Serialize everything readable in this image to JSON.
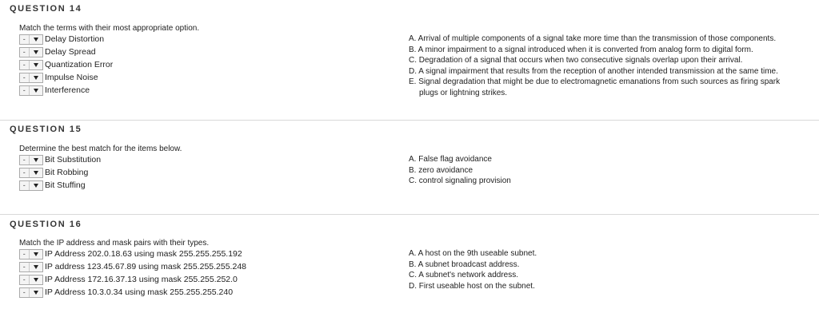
{
  "questions": [
    {
      "title": "QUESTION 14",
      "prompt": "Match the terms with their most appropriate option.",
      "terms": [
        "Delay Distortion",
        "Delay Spread",
        "Quantization Error",
        "Impulse Noise",
        "Interference"
      ],
      "dropdown_value": "-",
      "options": [
        "A. Arrival of multiple components of a signal take more time than the transmission of those components.",
        "B. A minor impairment to a signal introduced when it is converted from analog form to digital form.",
        "C. Degradation of a signal that occurs when two consecutive signals overlap upon their arrival.",
        "D. A signal impairment that results from the reception of another intended transmission at the same time.",
        "E. Signal degradation that might be due to electromagnetic emanations from such sources as firing spark"
      ],
      "option_continuation": "plugs or lightning strikes."
    },
    {
      "title": "QUESTION 15",
      "prompt": "Determine the best match for the items below.",
      "terms": [
        "Bit Substitution",
        "Bit Robbing",
        "Bit Stuffing"
      ],
      "dropdown_value": "-",
      "options": [
        "A. False flag avoidance",
        "B. zero avoidance",
        "C. control signaling provision"
      ]
    },
    {
      "title": "QUESTION 16",
      "prompt": "Match the IP address and mask pairs with their types.",
      "terms": [
        "IP Address 202.0.18.63 using mask 255.255.255.192",
        "IP address 123.45.67.89 using mask 255.255.255.248",
        "IP Address 172.16.37.13 using mask 255.255.252.0",
        "IP Address 10.3.0.34 using mask 255.255.255.240"
      ],
      "dropdown_value": "-",
      "options": [
        "A. A host on the 9th useable subnet.",
        "B. A subnet broadcast address.",
        "C. A subnet's network address.",
        "D. First useable host on the subnet."
      ]
    }
  ]
}
